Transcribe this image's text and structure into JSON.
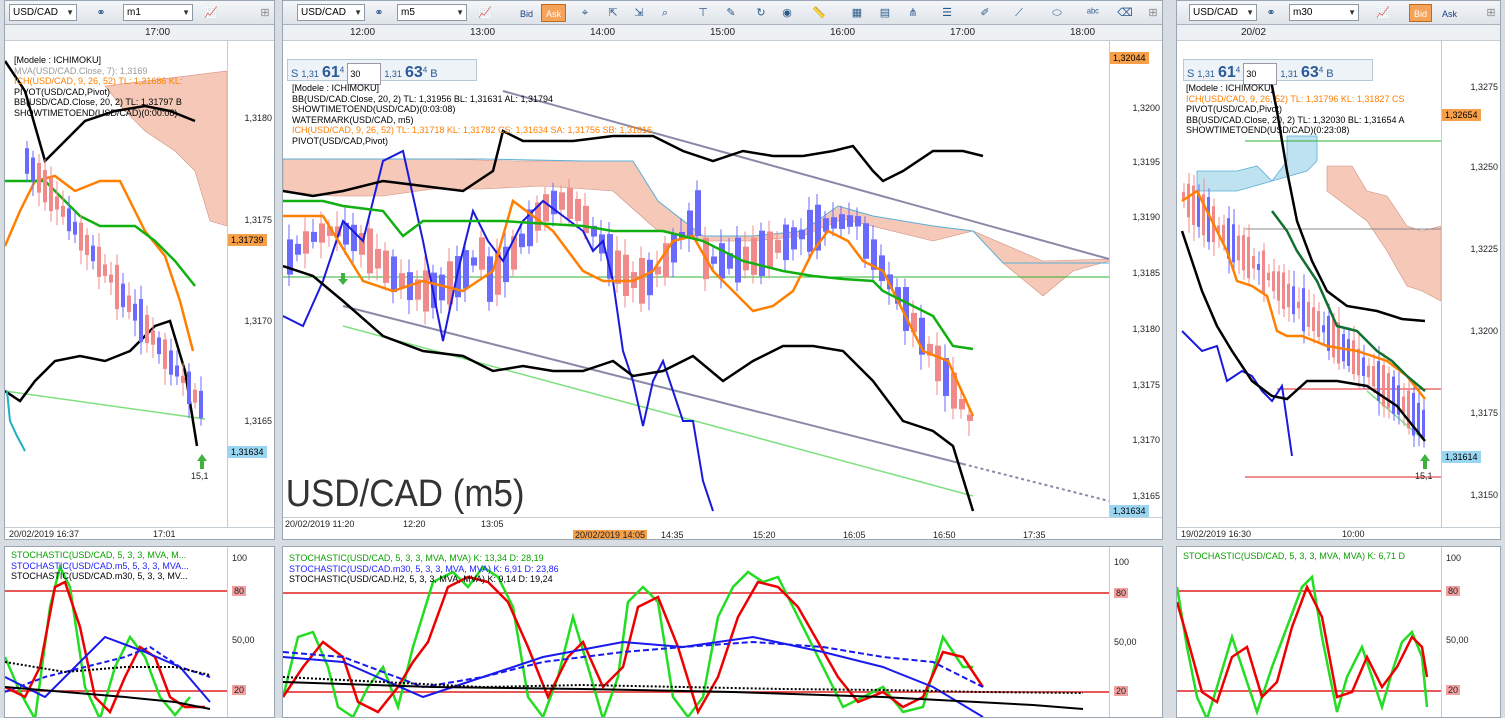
{
  "left": {
    "symbol": "USD/CAD",
    "timeframe": "m1",
    "top_time": "17:00",
    "legend": [
      {
        "text": "[Modele : ICHIMOKU]",
        "cls": ""
      },
      {
        "text": "MVA(USD/CAD.Close, 7): 1,3169",
        "cls": "l-gray"
      },
      {
        "text": "ICH(USD/CAD, 9, 26, 52)  TL: 1,31686  KL:",
        "cls": "l-orange"
      },
      {
        "text": "PIVOT(USD/CAD,Pivot)",
        "cls": ""
      },
      {
        "text": "BB(USD/CAD.Close, 20, 2)  TL: 1,31797  B",
        "cls": ""
      },
      {
        "text": "SHOWTIMETOEND(USD/CAD)(0:00:08)",
        "cls": ""
      }
    ],
    "prices": [
      "1,3180",
      "1,3175",
      "1,3170",
      "1,3165"
    ],
    "badge_orange": "1,31739",
    "badge_blue": "1,31634",
    "arrow_label": "15,1",
    "bottom_times": [
      "20/02/2019 16:37",
      "17:01"
    ],
    "stoch_legend": [
      {
        "text": "STOCHASTIC(USD/CAD, 5, 3, 3, MVA, M...",
        "cls": "l-green"
      },
      {
        "text": "STOCHASTIC(USD/CAD.m5, 5, 3, 3, MVA...",
        "cls": "l-blue"
      },
      {
        "text": "STOCHASTIC(USD/CAD.m30, 5, 3, 3, MV...",
        "cls": ""
      }
    ],
    "stoch_levels": [
      "100",
      "80",
      "50,00",
      "20"
    ]
  },
  "middle": {
    "symbol": "USD/CAD",
    "timeframe": "m5",
    "bid_label": "Bid",
    "ask_label": "Ask",
    "top_times": [
      "12:00",
      "13:00",
      "14:00",
      "15:00",
      "16:00",
      "17:00",
      "18:00"
    ],
    "sell_label": "S",
    "sell_prefix": "1,31",
    "sell_big": "61",
    "sell_sup": "4",
    "quantity": "30",
    "buy_prefix": "1,31",
    "buy_big": "63",
    "buy_sup": "4",
    "buy_label": "B",
    "legend": [
      {
        "text": "[Modele : ICHIMOKU]",
        "cls": ""
      },
      {
        "text": "BB(USD/CAD.Close, 20, 2)  TL: 1,31956  BL: 1,31631   AL: 1,31794",
        "cls": ""
      },
      {
        "text": "SHOWTIMETOEND(USD/CAD)(0:03:08)",
        "cls": ""
      },
      {
        "text": "WATERMARK(USD/CAD, m5)",
        "cls": ""
      },
      {
        "text": "ICH(USD/CAD, 9, 26, 52)  TL: 1,31718   KL: 1,31782   CS: 1,31634   SA: 1,31756   SB: 1,31816",
        "cls": "l-orange"
      },
      {
        "text": "PIVOT(USD/CAD,Pivot)",
        "cls": ""
      }
    ],
    "watermark": "USD/CAD (m5)",
    "prices": [
      "1,3200",
      "1,3195",
      "1,3190",
      "1,3185",
      "1,3180",
      "1,3175",
      "1,3170",
      "1,3165"
    ],
    "badge_top": "1,32044",
    "badge_blue": "1,31634",
    "bottom_times": [
      "20/02/2019 11:20",
      "12:20",
      "13:05",
      "20/02/2019 14:05",
      "14:35",
      "15:20",
      "16:05",
      "16:50",
      "17:35"
    ],
    "stoch_legend": [
      {
        "text": "STOCHASTIC(USD/CAD, 5, 3, 3, MVA, MVA)  K: 13,34   D: 28,19",
        "cls": "l-green"
      },
      {
        "text": "STOCHASTIC(USD/CAD.m30, 5, 3, 3, MVA, MVA)  K: 6,91   D: 23,86",
        "cls": "l-blue"
      },
      {
        "text": "STOCHASTIC(USD/CAD.H2, 5, 3, 3, MVA, MVA)  K: 9,14   D: 19,24",
        "cls": ""
      }
    ],
    "stoch_levels": [
      "100",
      "80",
      "50,00",
      "20"
    ]
  },
  "right": {
    "symbol": "USD/CAD",
    "timeframe": "m30",
    "bid_label": "Bid",
    "ask_label": "Ask",
    "top_time": "20/02",
    "sell_label": "S",
    "sell_prefix": "1,31",
    "sell_big": "61",
    "sell_sup": "4",
    "quantity": "30",
    "buy_prefix": "1,31",
    "buy_big": "63",
    "buy_sup": "4",
    "buy_label": "B",
    "legend": [
      {
        "text": "[Modele : ICHIMOKU]",
        "cls": ""
      },
      {
        "text": "ICH(USD/CAD, 9, 26, 52)  TL: 1,31796   KL: 1,31827   CS",
        "cls": "l-orange"
      },
      {
        "text": "PIVOT(USD/CAD,Pivot)",
        "cls": ""
      },
      {
        "text": "BB(USD/CAD.Close, 20, 2)  TL: 1,32030  BL: 1,31654   A",
        "cls": ""
      },
      {
        "text": "SHOWTIMETOEND(USD/CAD)(0:23:08)",
        "cls": ""
      }
    ],
    "prices": [
      "1,3275",
      "1,3250",
      "1,3225",
      "1,3200",
      "1,3175",
      "1,3150"
    ],
    "badge_orange": "1,32654",
    "badge_blue": "1,31614",
    "arrow_label": "15,1",
    "bottom_times": [
      "19/02/2019 16:30",
      "10:00"
    ],
    "stoch_legend": [
      {
        "text": "STOCHASTIC(USD/CAD, 5, 3, 3, MVA, MVA)  K: 6,71   D",
        "cls": "l-green"
      }
    ],
    "stoch_levels": [
      "100",
      "80",
      "50,00",
      "20"
    ]
  },
  "colors": {
    "bull_candle": "#6a6aff",
    "bear_candle": "#f08a8a",
    "bb_line": "#000000",
    "tenkan": "#ff7f00",
    "kijun": "#00a000",
    "cloud_fill": "#f5c8b8",
    "trendline": "#8a8aa8",
    "stoch_k": "#22dd22",
    "stoch_d": "#ee0000",
    "stoch_m30": "#1a1aee",
    "badge_orange": "#f7a04a",
    "badge_blue": "#9ad6f2"
  }
}
